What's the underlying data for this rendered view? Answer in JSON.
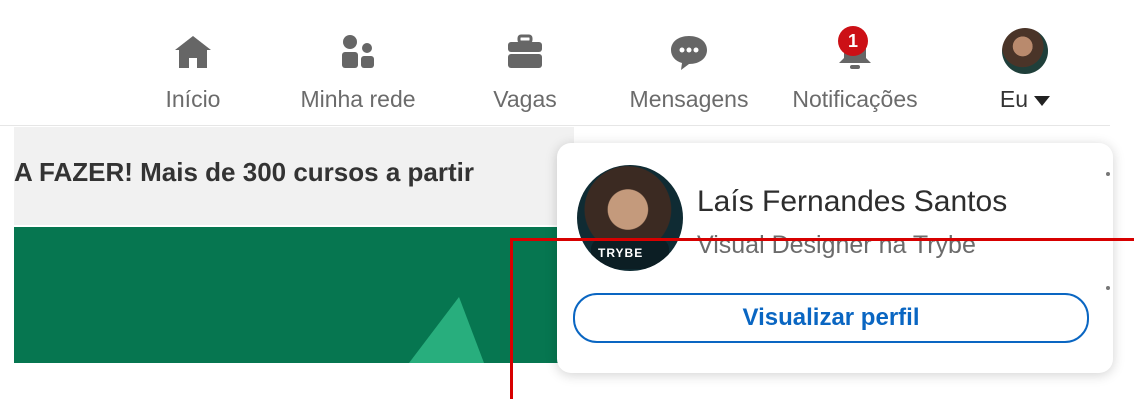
{
  "nav": {
    "items": [
      {
        "label": "Início",
        "icon": "home-icon"
      },
      {
        "label": "Minha rede",
        "icon": "network-icon"
      },
      {
        "label": "Vagas",
        "icon": "briefcase-icon"
      },
      {
        "label": "Mensagens",
        "icon": "message-icon"
      },
      {
        "label": "Notificações",
        "icon": "bell-icon",
        "badge": "1"
      },
      {
        "label": "Eu",
        "icon": "avatar"
      }
    ]
  },
  "banner": {
    "text": "A FAZER! Mais de 300 cursos a partir"
  },
  "profile_menu": {
    "name": "Laís Fernandes Santos",
    "title": "Visual Designer na Trybe",
    "shirt_text": "TRYBE",
    "view_profile_label": "Visualizar perfil"
  },
  "colors": {
    "accent_blue": "#0a66c2",
    "badge_red": "#cc1016",
    "promo_green": "#067650",
    "annotation_red": "#d70000"
  }
}
